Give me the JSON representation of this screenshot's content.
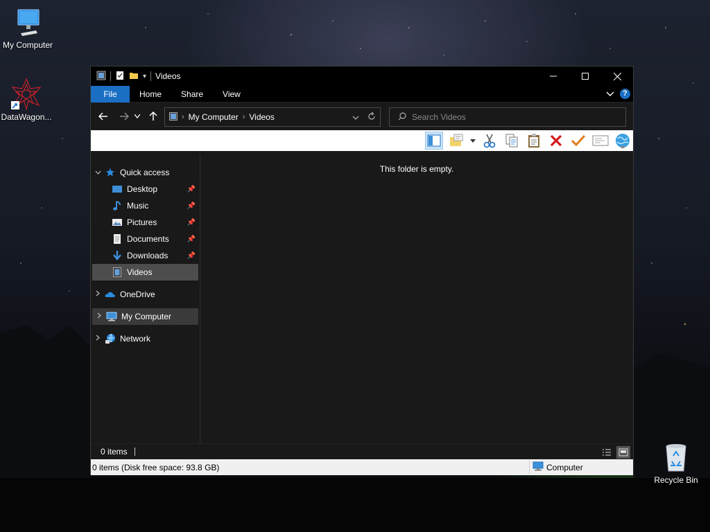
{
  "desktop": {
    "icons": [
      {
        "label": "My Computer"
      },
      {
        "label": "DataWagon..."
      },
      {
        "label": "Recycle Bin"
      }
    ]
  },
  "window": {
    "title": "Videos",
    "ribbon_tabs": [
      "File",
      "Home",
      "Share",
      "View"
    ],
    "help_label": "?",
    "address": {
      "crumbs": [
        "My Computer",
        "Videos"
      ]
    },
    "search": {
      "placeholder": "Search Videos"
    },
    "nav": {
      "quick_access": "Quick access",
      "items": [
        {
          "label": "Desktop",
          "icon": "desktop-icon",
          "pinned": true
        },
        {
          "label": "Music",
          "icon": "music-icon",
          "pinned": true
        },
        {
          "label": "Pictures",
          "icon": "pictures-icon",
          "pinned": true
        },
        {
          "label": "Documents",
          "icon": "documents-icon",
          "pinned": true
        },
        {
          "label": "Downloads",
          "icon": "downloads-icon",
          "pinned": true
        },
        {
          "label": "Videos",
          "icon": "videos-icon",
          "pinned": false,
          "selected": true
        }
      ],
      "onedrive": "OneDrive",
      "my_computer": "My Computer",
      "network": "Network"
    },
    "content": {
      "empty_text": "This folder is empty."
    },
    "status": {
      "count": "0 items"
    },
    "infobar": {
      "left": "0 items (Disk free space: 93.8 GB)",
      "right": "Computer"
    }
  },
  "colors": {
    "accent": "#1a6fc4",
    "selected": "#4d4d4d"
  }
}
